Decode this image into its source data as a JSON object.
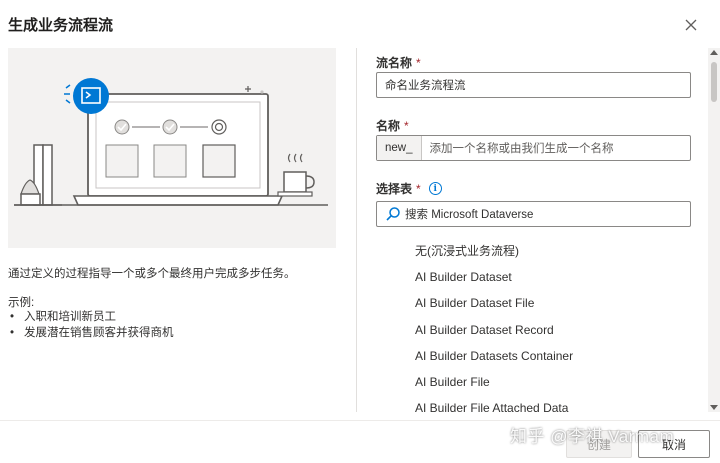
{
  "dialog": {
    "title": "生成业务流程流",
    "close_icon": "close-icon"
  },
  "left": {
    "description": "通过定义的过程指导一个或多个最终用户完成多步任务。",
    "examples_label": "示例:",
    "examples": [
      "入职和培训新员工",
      "发展潜在销售顾客并获得商机"
    ]
  },
  "form": {
    "flow_name": {
      "label": "流名称",
      "required_mark": "*",
      "value": "命名业务流程流"
    },
    "name": {
      "label": "名称",
      "required_mark": "*",
      "prefix": "new_",
      "placeholder": "添加一个名称或由我们生成一个名称"
    },
    "select_table": {
      "label": "选择表",
      "required_mark": "*",
      "info_icon": "info-icon",
      "info_glyph": "i",
      "search_placeholder": "搜索 Microsoft Dataverse"
    }
  },
  "table_list": [
    "无(沉浸式业务流程)",
    "AI Builder Dataset",
    "AI Builder Dataset File",
    "AI Builder Dataset Record",
    "AI Builder Datasets Container",
    "AI Builder File",
    "AI Builder File Attached Data"
  ],
  "footer": {
    "create_label": "创建",
    "cancel_label": "取消"
  },
  "watermark": "知乎 @李祺 Varmam",
  "colors": {
    "accent": "#0078d4",
    "required": "#a4262c",
    "illustration_bg": "#f3f2f1"
  }
}
